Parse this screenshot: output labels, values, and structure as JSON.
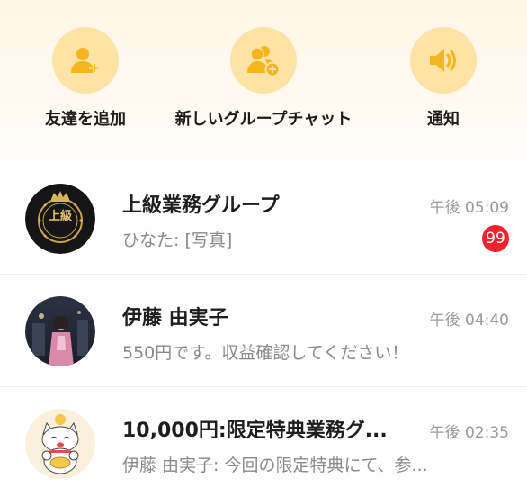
{
  "colors": {
    "accent": "#f5b51e",
    "icon_bg": "#ffe3a6",
    "badge": "#f5222d"
  },
  "quick_actions": [
    {
      "label": "友達を追加",
      "icon": "add-friend-icon"
    },
    {
      "label": "新しいグループチャット",
      "icon": "new-group-icon"
    },
    {
      "label": "通知",
      "icon": "speaker-icon"
    }
  ],
  "chats": [
    {
      "name": "上級業務グループ",
      "time": "午後 05:09",
      "preview": "ひなた: [写真]",
      "badge": "99",
      "avatar_text": "上級",
      "avatar_icon": "crown-emblem-avatar"
    },
    {
      "name": "伊藤 由実子",
      "time": "午後 04:40",
      "preview": "550円です。収益確認してください！",
      "avatar_icon": "photo-avatar"
    },
    {
      "name": "10,000円:限定特典業務グ...",
      "time": "午後 02:35",
      "preview": "伊藤 由実子: 今回の限定特典にて、参...",
      "avatar_icon": "lucky-cat-avatar"
    }
  ]
}
